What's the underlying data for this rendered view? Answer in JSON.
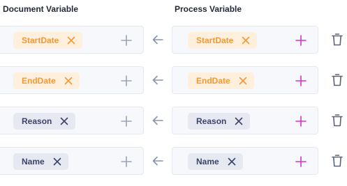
{
  "headers": {
    "document_variable": "Document Variable",
    "process_variable": "Process Variable"
  },
  "rows": [
    {
      "document": {
        "label": "StartDate",
        "style": "orange",
        "remove_icon": "close-icon"
      },
      "process": {
        "label": "StartDate",
        "style": "orange",
        "remove_icon": "close-icon"
      }
    },
    {
      "document": {
        "label": "EndDate",
        "style": "orange",
        "remove_icon": "close-icon"
      },
      "process": {
        "label": "EndDate",
        "style": "orange",
        "remove_icon": "close-icon"
      }
    },
    {
      "document": {
        "label": "Reason",
        "style": "gray",
        "remove_icon": "close-icon"
      },
      "process": {
        "label": "Reason",
        "style": "gray",
        "remove_icon": "close-icon"
      }
    },
    {
      "document": {
        "label": "Name",
        "style": "gray",
        "remove_icon": "close-icon"
      },
      "process": {
        "label": "Name",
        "style": "gray",
        "remove_icon": "close-icon"
      }
    }
  ],
  "icons": {
    "document_add": "plus-icon",
    "process_add": "plus-icon",
    "mapping": "arrow-left-icon",
    "delete": "trash-icon"
  },
  "colors": {
    "orange_chip_bg": "#fef0dc",
    "orange_chip_text": "#f0993a",
    "gray_chip_bg": "#e6e9f1",
    "gray_chip_text": "#3c4467",
    "doc_plus": "#9aa3b5",
    "process_plus": "#d633c2",
    "arrow": "#8a93a8",
    "trash": "#5b6275"
  }
}
